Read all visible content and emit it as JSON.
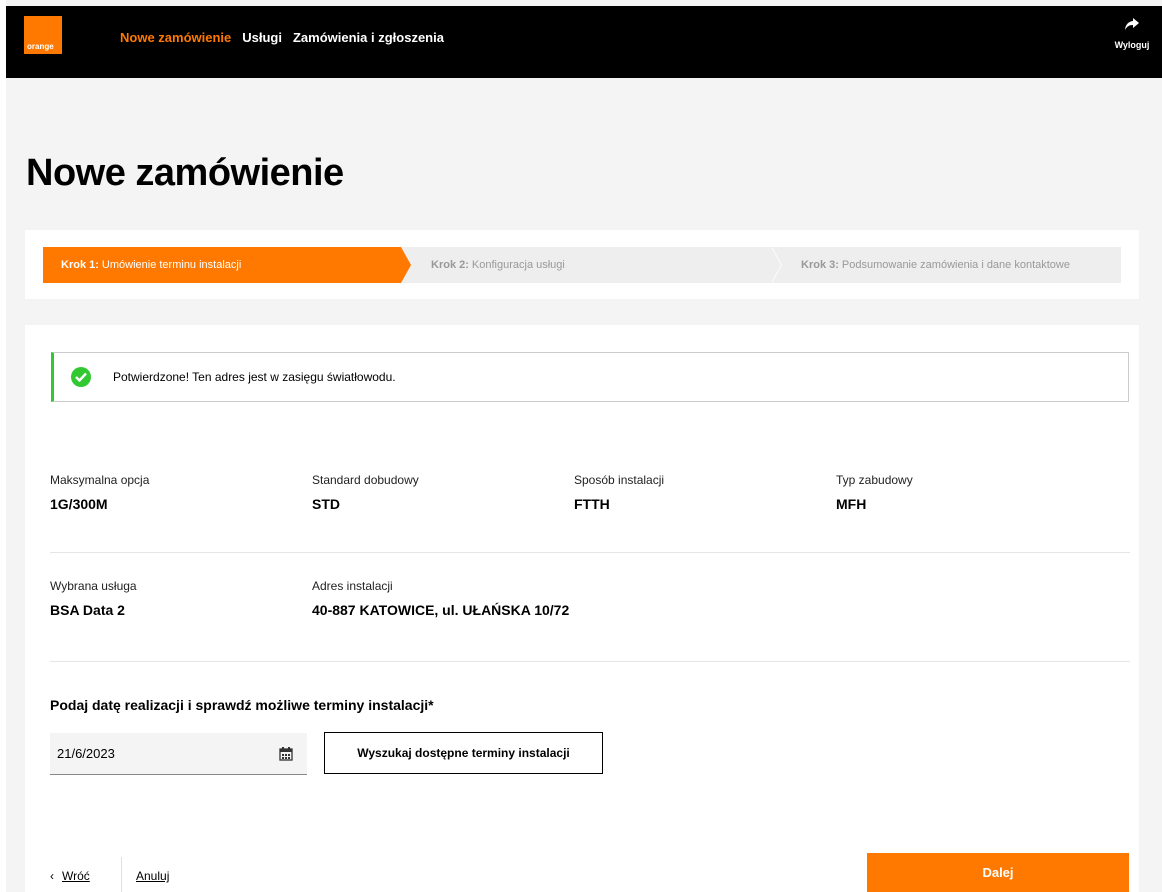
{
  "header": {
    "logo_text": "orange",
    "nav": [
      {
        "label": "Nowe zamówienie",
        "active": true
      },
      {
        "label": "Usługi",
        "active": false
      },
      {
        "label": "Zamówienia i zgłoszenia",
        "active": false
      }
    ],
    "logout_label": "Wyloguj"
  },
  "page_title": "Nowe zamówienie",
  "steps": [
    {
      "prefix": "Krok 1:",
      "label": "Umówienie terminu instalacji",
      "active": true
    },
    {
      "prefix": "Krok 2:",
      "label": "Konfiguracja usługi",
      "active": false
    },
    {
      "prefix": "Krok 3:",
      "label": "Podsumowanie zamówienia i dane kontaktowe",
      "active": false
    }
  ],
  "alert": {
    "text": "Potwierdzone! Ten adres jest w zasięgu światłowodu."
  },
  "info_row1": [
    {
      "label": "Maksymalna opcja",
      "value": "1G/300M"
    },
    {
      "label": "Standard dobudowy",
      "value": "STD"
    },
    {
      "label": "Sposób instalacji",
      "value": "FTTH"
    },
    {
      "label": "Typ zabudowy",
      "value": "MFH"
    }
  ],
  "info_row2": [
    {
      "label": "Wybrana usługa",
      "value": "BSA Data 2"
    },
    {
      "label": "Adres instalacji",
      "value": "40-887 KATOWICE, ul. UŁAŃSKA 10/72"
    }
  ],
  "date_section": {
    "label": "Podaj datę realizacji i sprawdź możliwe terminy instalacji*",
    "date_value": "21/6/2023",
    "search_button": "Wyszukaj dostępne terminy instalacji"
  },
  "footer": {
    "back_label": "Wróć",
    "cancel_label": "Anuluj",
    "next_label": "Dalej"
  },
  "colors": {
    "brand": "#ff7900",
    "success": "#32c832"
  }
}
